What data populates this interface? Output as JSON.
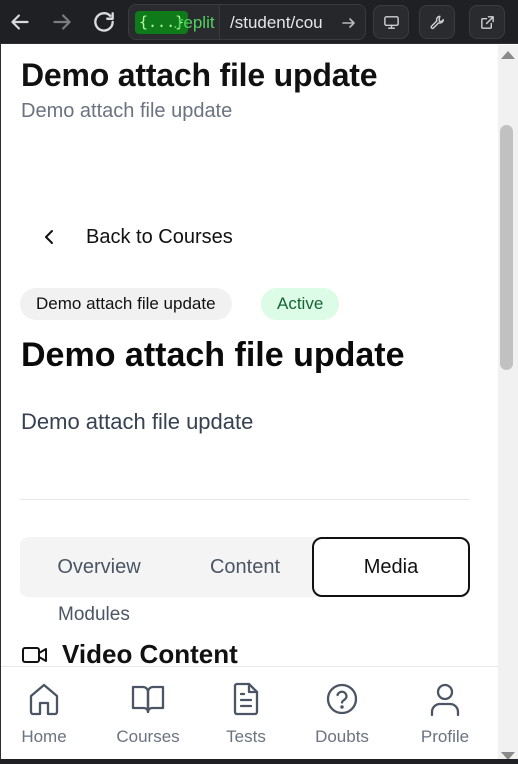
{
  "browser": {
    "code_badge": "{...}",
    "host": ".replit",
    "path": "/student/cou"
  },
  "header": {
    "title": "Demo attach file update",
    "subtitle": "Demo attach file update"
  },
  "back": {
    "label": "Back to Courses"
  },
  "course": {
    "chip_label": "Demo attach file update",
    "status": "Active",
    "status_color": "#166534",
    "title": "Demo attach file update",
    "description": "Demo attach file update"
  },
  "tabs": {
    "items": [
      "Overview",
      "Content",
      "Media"
    ],
    "selected": "Media",
    "modules": "Modules"
  },
  "section": {
    "title": "Video Content",
    "icon": "video-icon"
  },
  "bottom_nav": {
    "items": [
      {
        "label": "Home",
        "icon": "home-icon"
      },
      {
        "label": "Courses",
        "icon": "book-icon"
      },
      {
        "label": "Tests",
        "icon": "document-icon"
      },
      {
        "label": "Doubts",
        "icon": "help-circle-icon"
      },
      {
        "label": "Profile",
        "icon": "user-icon"
      }
    ]
  }
}
